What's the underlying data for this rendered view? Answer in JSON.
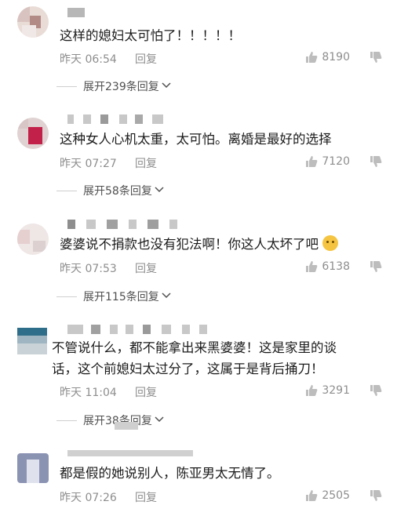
{
  "comments": [
    {
      "text": "这样的媳妇太可怕了！！！！！",
      "time": "昨天 06:54",
      "reply": "回复",
      "likes": "8190",
      "expand": "展开239条回复"
    },
    {
      "text": "这种女人心机太重，太可怕。离婚是最好的选择",
      "time": "昨天 07:27",
      "reply": "回复",
      "likes": "7120",
      "expand": "展开58条回复"
    },
    {
      "text": "婆婆说不捐款也没有犯法啊！你这人太坏了吧",
      "time": "昨天 07:53",
      "reply": "回复",
      "likes": "6138",
      "expand": "展开115条回复"
    },
    {
      "text_line1": "不管说什么，都不能拿出来黑婆婆！这是家里的谈",
      "text_line2": "话，这个前媳妇太过分了，这属于是背后捅刀！",
      "time": "昨天 11:04",
      "reply": "回复",
      "likes": "3291",
      "expand": "展开38条回复"
    },
    {
      "text": "都是假的她说别人，陈亚男太无情了。",
      "time": "昨天 07:26",
      "reply": "回复",
      "likes": "2505"
    }
  ],
  "icons": {
    "like": "thumbs-up-icon",
    "dislike": "thumbs-down-icon",
    "expand": "chevron-down-icon",
    "emoji": "flushed-face-emoji"
  },
  "colors": {
    "text": "#1b1b1b",
    "meta": "#8e8e8e",
    "expand": "#505050"
  }
}
